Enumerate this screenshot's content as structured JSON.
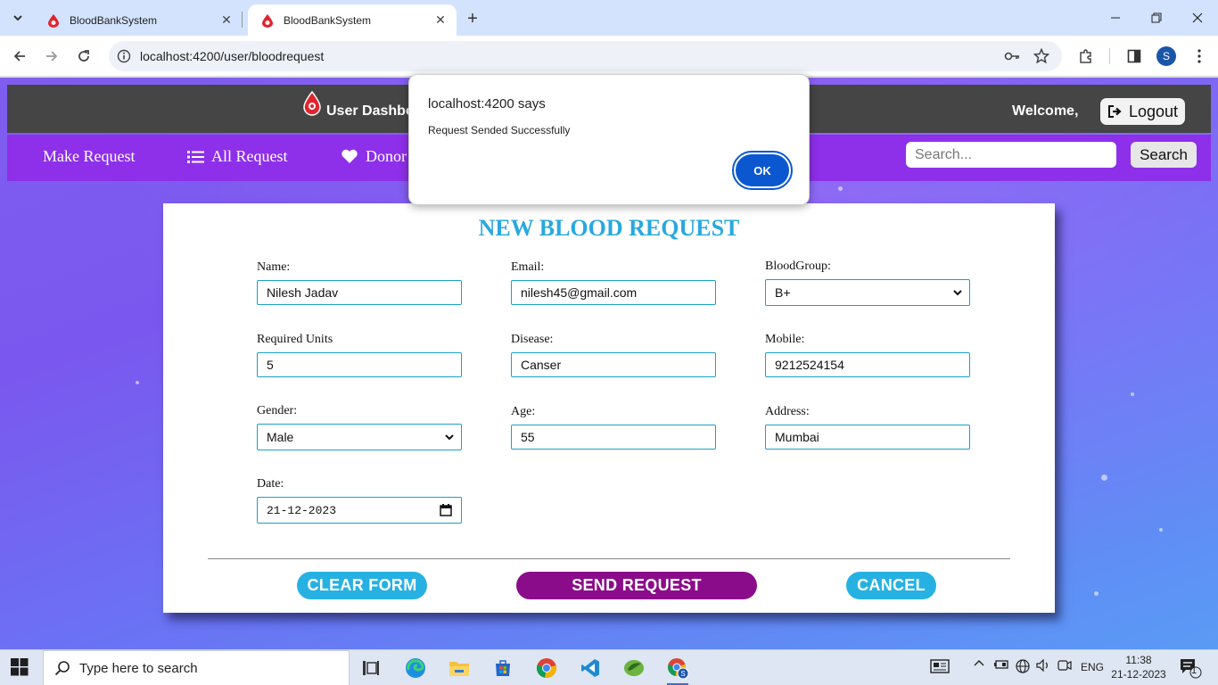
{
  "browser": {
    "tabs": [
      {
        "title": "BloodBankSystem",
        "active": false
      },
      {
        "title": "BloodBankSystem",
        "active": true
      }
    ],
    "url": "localhost:4200/user/bloodrequest"
  },
  "app": {
    "title": "User Dashbo",
    "welcome": "Welcome,",
    "logout": "Logout",
    "nav": {
      "make_request": "Make Request",
      "all_request": "All Request",
      "donor": "Donor"
    },
    "search": {
      "placeholder": "Search...",
      "button": "Search"
    }
  },
  "form": {
    "title": "NEW BLOOD REQUEST",
    "fields": {
      "name": {
        "label": "Name:",
        "value": "Nilesh Jadav"
      },
      "email": {
        "label": "Email:",
        "value": "nilesh45@gmail.com"
      },
      "bloodgroup": {
        "label": "BloodGroup:",
        "value": "B+"
      },
      "units": {
        "label": "Required Units",
        "value": "5"
      },
      "disease": {
        "label": "Disease:",
        "value": "Canser"
      },
      "mobile": {
        "label": "Mobile:",
        "value": "9212524154"
      },
      "gender": {
        "label": "Gender:",
        "value": "Male"
      },
      "age": {
        "label": "Age:",
        "value": "55"
      },
      "address": {
        "label": "Address:",
        "value": "Mumbai"
      },
      "date": {
        "label": "Date:",
        "value": "21-12-2023"
      }
    },
    "buttons": {
      "clear": "CLEAR FORM",
      "send": "SEND REQUEST",
      "cancel": "CANCEL"
    }
  },
  "dialog": {
    "title": "localhost:4200 says",
    "message": "Request Sended Successfully",
    "ok": "OK"
  },
  "taskbar": {
    "search_placeholder": "Type here to search",
    "language": "ENG",
    "time": "11:38",
    "date": "21-12-2023",
    "notifications": "1"
  },
  "colors": {
    "nav_purple": "#8e2fea",
    "header_gray": "#454545",
    "title_blue": "#29a8df",
    "send_button": "#8b0c8a",
    "clear_button": "#26b1e2",
    "dialog_ok": "#0b57d0"
  }
}
